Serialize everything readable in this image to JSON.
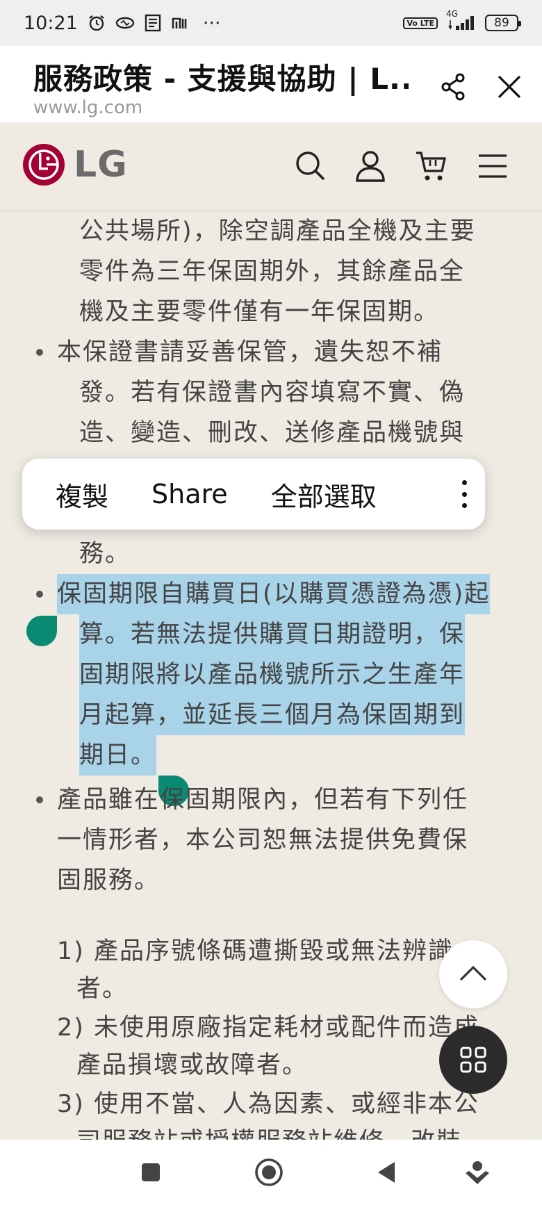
{
  "status": {
    "time": "10:21",
    "icons_left": [
      "alarm-icon",
      "cast-icon",
      "app-icon",
      "mi-icon"
    ],
    "more": "···",
    "volte": "Vo LTE",
    "network": "4G",
    "battery": "89"
  },
  "browser": {
    "title": "服務政策 - 支援與協助 | L...",
    "url": "www.lg.com"
  },
  "site": {
    "logo_text": "LG",
    "brand_color": "#a50034"
  },
  "content": {
    "lines": [
      "公共場所)，除空調產品全機及主要",
      "零件為三年保固期外，其餘產品全",
      "機及主要零件僅有一年保固期。",
      "本保證書請妥善保管，遺失恕不補",
      "發。若有保證書內容填寫不實、偽",
      "造、變造、刪改、送修產品機號與",
      "務。",
      "保固期限自購買日(以購買憑證為憑)起",
      "算。若無法提供購買日期證明，保",
      "固期限將以產品機號所示之生產年",
      "月起算，並延長三個月為保固期到",
      "期日。",
      "產品雖在保固期限內，但若有下列任",
      "一情形者，本公司恕無法提供免費保",
      "固服務。",
      "1)  產品序號條碼遭撕毀或無法辨識",
      "者。",
      "2)  未使用原廠指定耗材或配件而造成",
      "產品損壞或故障者。",
      "3)  使用不當、人為因素、或經非本公",
      "司服務站或授權服務站維修、改裝"
    ]
  },
  "context_menu": {
    "copy": "複製",
    "share": "Share",
    "select_all": "全部選取"
  },
  "colors": {
    "page_bg": "#efebe3",
    "highlight": "#a9d3e8",
    "handle": "#0b8a73"
  }
}
